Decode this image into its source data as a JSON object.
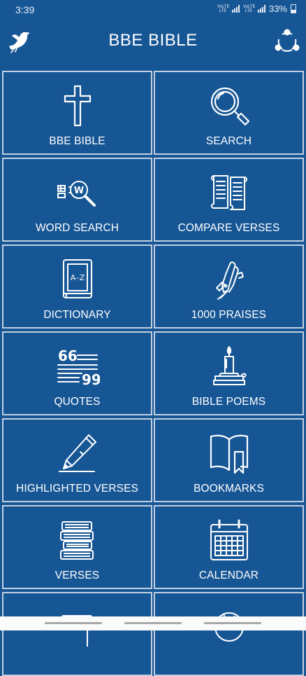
{
  "status": {
    "time": "3:39",
    "battery": "33%",
    "net1": "VoLTE LTE",
    "net2": "VoLTE LTE"
  },
  "header": {
    "title": "BBE BIBLE",
    "left_icon": "dove-icon",
    "right_icon": "share-icon"
  },
  "tiles": [
    {
      "label": "BBE BIBLE",
      "icon": "cross-icon"
    },
    {
      "label": "SEARCH",
      "icon": "magnifier-icon"
    },
    {
      "label": "WORD SEARCH",
      "icon": "word-search-icon"
    },
    {
      "label": "COMPARE VERSES",
      "icon": "scrolls-icon"
    },
    {
      "label": "DICTIONARY",
      "icon": "dictionary-icon"
    },
    {
      "label": "1000 PRAISES",
      "icon": "praying-hands-icon"
    },
    {
      "label": "QUOTES",
      "icon": "quotes-icon"
    },
    {
      "label": "BIBLE POEMS",
      "icon": "candle-icon"
    },
    {
      "label": "HIGHLIGHTED VERSES",
      "icon": "pencil-icon"
    },
    {
      "label": "BOOKMARKS",
      "icon": "bookmark-book-icon"
    },
    {
      "label": "VERSES",
      "icon": "book-stack-icon"
    },
    {
      "label": "CALENDAR",
      "icon": "calendar-icon"
    },
    {
      "label": "",
      "icon": "scroll-icon"
    },
    {
      "label": "",
      "icon": "globe-icon"
    }
  ],
  "colors": {
    "background": "#175695",
    "tile_border": "#c2d0e1",
    "text": "#ffffff"
  }
}
